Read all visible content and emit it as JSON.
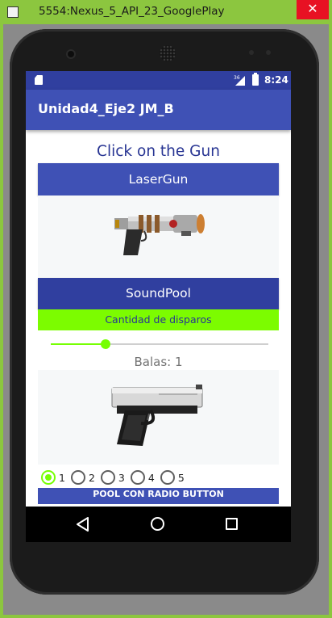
{
  "window": {
    "title": "5554:Nexus_5_API_23_GooglePlay",
    "close_glyph": "✕"
  },
  "status_bar": {
    "time": "8:24",
    "signal": "36"
  },
  "app_bar": {
    "title": "Unidad4_Eje2 JM_B"
  },
  "main": {
    "heading": "Click on the Gun",
    "laser_button": "LaserGun",
    "soundpool_button": "SoundPool",
    "count_button": "Cantidad de disparos",
    "slider": {
      "value": 1,
      "fraction": 0.25
    },
    "balas_text": "Balas: 1",
    "radio_options": [
      "1",
      "2",
      "3",
      "4",
      "5"
    ],
    "radio_selected_index": 0,
    "pool_button": "POOL CON RADIO BUTTON"
  },
  "colors": {
    "accent": "#76ff03",
    "primary": "#3f51b5",
    "primary_dark": "#303f9f",
    "window_frame": "#8cc63f"
  },
  "icons": [
    "sd-card-icon",
    "signal-icon",
    "battery-icon",
    "back-icon",
    "home-icon",
    "recents-icon",
    "laser-gun-image",
    "pistol-image"
  ]
}
